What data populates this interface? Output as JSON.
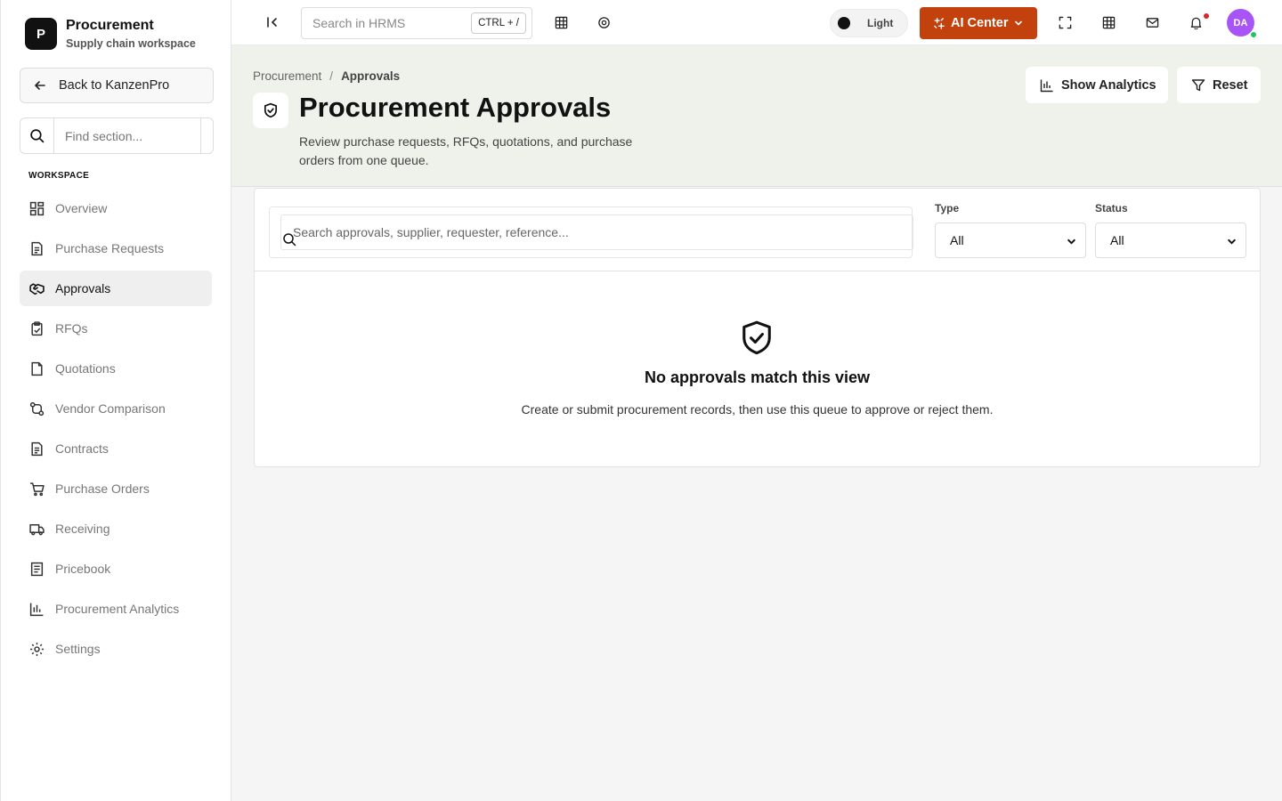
{
  "sidebar": {
    "brand_letter": "P",
    "brand_title": "Procurement",
    "brand_subtitle": "Supply chain workspace",
    "back_label": "Back to KanzenPro",
    "find_placeholder": "Find section...",
    "section_label": "WORKSPACE",
    "items": [
      {
        "label": "Overview",
        "icon": "grid-icon"
      },
      {
        "label": "Purchase Requests",
        "icon": "document-icon"
      },
      {
        "label": "Approvals",
        "icon": "handshake-icon",
        "active": true
      },
      {
        "label": "RFQs",
        "icon": "clipboard-icon"
      },
      {
        "label": "Quotations",
        "icon": "file-icon"
      },
      {
        "label": "Vendor Comparison",
        "icon": "compare-icon"
      },
      {
        "label": "Contracts",
        "icon": "document-icon"
      },
      {
        "label": "Purchase Orders",
        "icon": "cart-icon"
      },
      {
        "label": "Receiving",
        "icon": "truck-icon"
      },
      {
        "label": "Pricebook",
        "icon": "book-icon"
      },
      {
        "label": "Procurement Analytics",
        "icon": "bar-chart-icon"
      },
      {
        "label": "Settings",
        "icon": "gear-icon"
      }
    ]
  },
  "topbar": {
    "search_placeholder": "Search in HRMS",
    "shortcut": "CTRL + /",
    "theme_label": "Light",
    "ai_label": "AI Center",
    "avatar_initials": "DA"
  },
  "header": {
    "breadcrumb_root": "Procurement",
    "breadcrumb_sep": "/",
    "breadcrumb_current": "Approvals",
    "title": "Procurement Approvals",
    "description": "Review purchase requests, RFQs, quotations, and purchase orders from one queue.",
    "analytics_label": "Show Analytics",
    "reset_label": "Reset"
  },
  "filters": {
    "search_placeholder": "Search approvals, supplier, requester, reference...",
    "type_label": "Type",
    "type_value": "All",
    "status_label": "Status",
    "status_value": "All"
  },
  "empty_state": {
    "title": "No approvals match this view",
    "description": "Create or submit procurement records, then use this queue to approve or reject them."
  },
  "colors": {
    "accent": "#c2410c",
    "avatar": "#a855f7",
    "header_bg": "#eef2ea",
    "notification": "#dc2626",
    "online": "#22c55e"
  }
}
